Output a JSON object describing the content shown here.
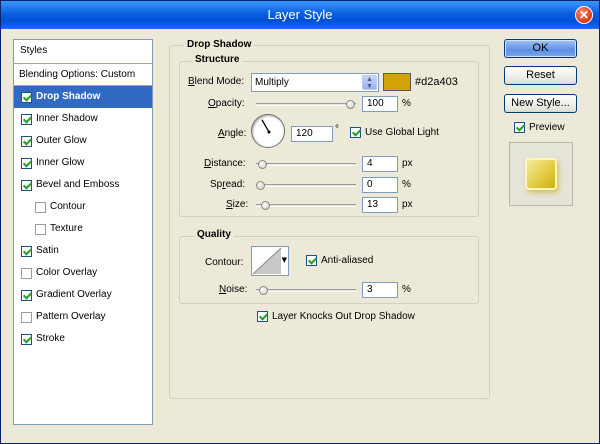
{
  "window": {
    "title": "Layer Style"
  },
  "styles": {
    "header": "Styles",
    "blending_options": "Blending Options: Custom",
    "items": [
      {
        "label": "Drop Shadow",
        "checked": true,
        "active": true,
        "sub": false
      },
      {
        "label": "Inner Shadow",
        "checked": true,
        "active": false,
        "sub": false
      },
      {
        "label": "Outer Glow",
        "checked": true,
        "active": false,
        "sub": false
      },
      {
        "label": "Inner Glow",
        "checked": true,
        "active": false,
        "sub": false
      },
      {
        "label": "Bevel and Emboss",
        "checked": true,
        "active": false,
        "sub": false
      },
      {
        "label": "Contour",
        "checked": false,
        "active": false,
        "sub": true
      },
      {
        "label": "Texture",
        "checked": false,
        "active": false,
        "sub": true
      },
      {
        "label": "Satin",
        "checked": true,
        "active": false,
        "sub": false
      },
      {
        "label": "Color Overlay",
        "checked": false,
        "active": false,
        "sub": false
      },
      {
        "label": "Gradient Overlay",
        "checked": true,
        "active": false,
        "sub": false
      },
      {
        "label": "Pattern Overlay",
        "checked": false,
        "active": false,
        "sub": false
      },
      {
        "label": "Stroke",
        "checked": true,
        "active": false,
        "sub": false
      }
    ]
  },
  "drop_shadow": {
    "title": "Drop Shadow",
    "structure_title": "Structure",
    "blend_mode_label": "Blend Mode:",
    "blend_mode_value": "Multiply",
    "color": "#d2a403",
    "color_label": "#d2a403",
    "opacity_label": "Opacity:",
    "opacity_value": "100",
    "opacity_unit": "%",
    "opacity_level": 1.0,
    "angle_label": "Angle:",
    "angle_value": "120",
    "angle_unit": "°",
    "use_global_light_label": "Use Global Light",
    "use_global_light": true,
    "distance_label": "Distance:",
    "distance_value": "4",
    "distance_unit": "px",
    "distance_level": 0.02,
    "spread_label": "Spread:",
    "spread_value": "0",
    "spread_unit": "%",
    "spread_level": 0.0,
    "size_label": "Size:",
    "size_value": "13",
    "size_unit": "px",
    "size_level": 0.05,
    "quality_title": "Quality",
    "contour_label": "Contour:",
    "anti_aliased_label": "Anti-aliased",
    "anti_aliased": true,
    "noise_label": "Noise:",
    "noise_value": "3",
    "noise_unit": "%",
    "noise_level": 0.03,
    "knockout_label": "Layer Knocks Out Drop Shadow",
    "knockout": true
  },
  "buttons": {
    "ok": "OK",
    "reset": "Reset",
    "new_style": "New Style...",
    "preview_label": "Preview",
    "preview": true
  }
}
